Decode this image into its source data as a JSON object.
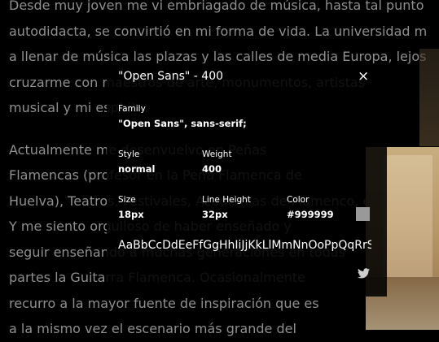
{
  "article": {
    "lines_1": [
      "Desde muy joven me vi embriagado de música, hasta tal punto",
      "autodidacta, se convirtió en mi forma de vida. La universidad m",
      "a llenar de música las plazas y las calles de media Europa, lejos",
      "cruzarme con maestros de arte, monumentos, artistas",
      "musical y mi espíritu."
    ],
    "lines_2": [
      "Actualmente me desenvuelvo en Peñas",
      "Flamencas (profesor en la Peña Flamenca de",
      "Huelva), Teatros, Festivales, Academias de Flamenco, etc.",
      "Y me siento orgulloso de haber enseñado y",
      "seguir enseñando a muchas generaciones en todas",
      "partes la Guitarra Flamenca. Ocasionalmente",
      "recurro a la mayor fuente de inspiración que es",
      "a la mismo vez el escenario más grande del"
    ]
  },
  "font_inspector": {
    "title": "\"Open Sans\" - 400",
    "close_symbol": "×",
    "family_label": "Family",
    "family_value": "\"Open Sans\", sans-serif;",
    "style_label": "Style",
    "style_value": "normal",
    "weight_label": "Weight",
    "weight_value": "400",
    "size_label": "Size",
    "size_value": "18px",
    "line_height_label": "Line Height",
    "line_height_value": "32px",
    "color_label": "Color",
    "color_value": "#999999",
    "sample_text": "AaBbCcDdEeFfGgHhIiJjKkLlMmNnOoPpQqRrSsTtUuVvWwXxYyZz",
    "swatch_color": "#999999",
    "share_icon": "twitter-icon"
  }
}
